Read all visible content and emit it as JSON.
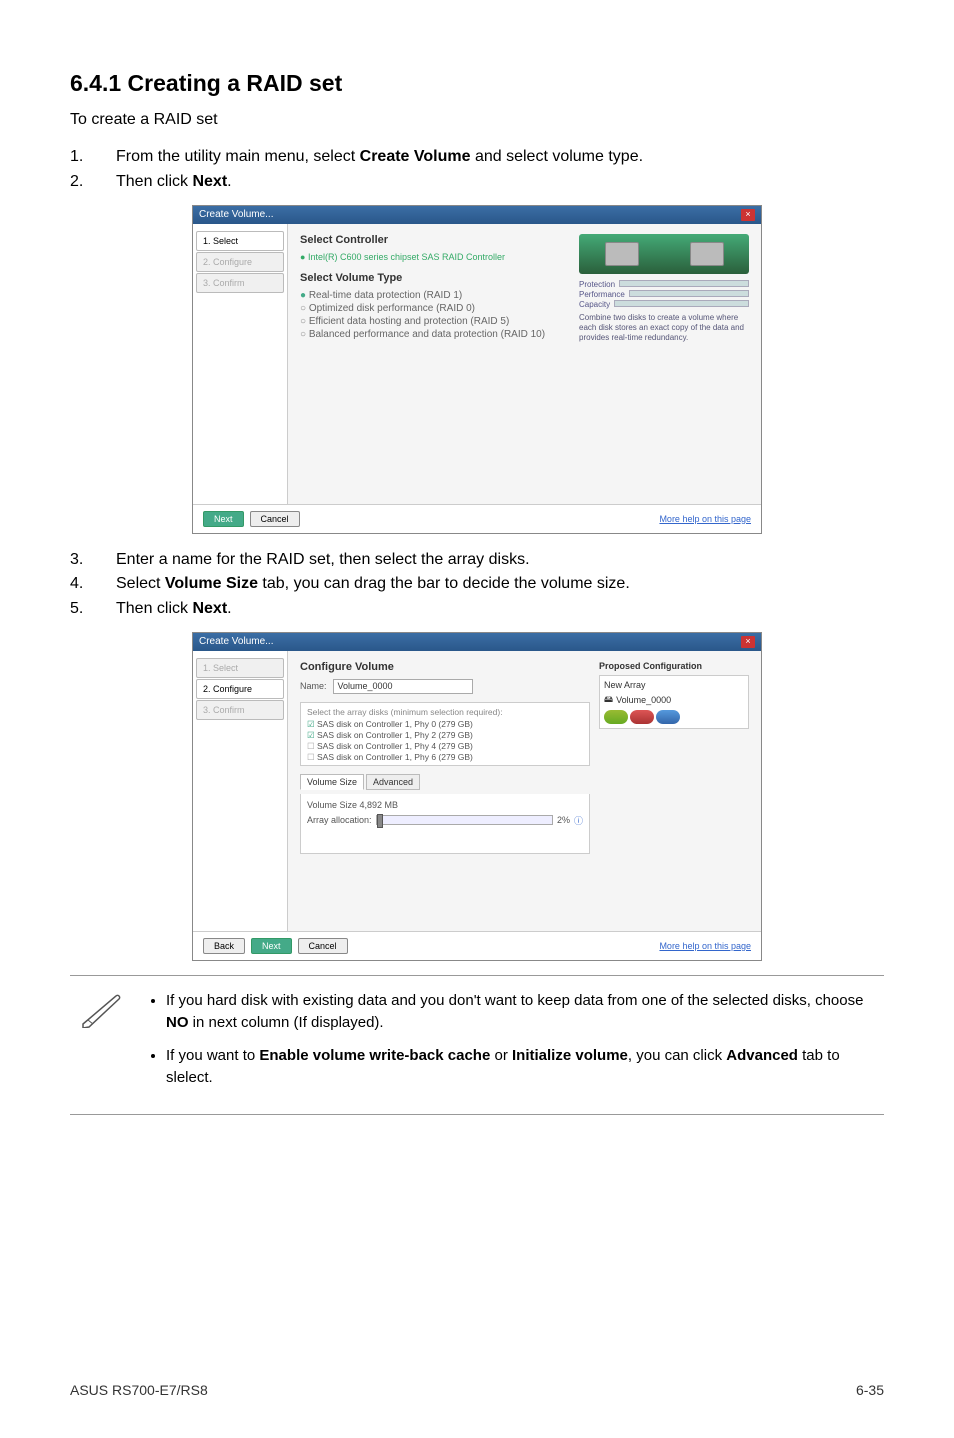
{
  "section": {
    "heading": "6.4.1    Creating a RAID set",
    "intro": "To create a RAID set"
  },
  "steps1": [
    {
      "num": "1.",
      "pre": "From the utility main menu, select ",
      "bold": "Create Volume",
      "post": " and select volume type."
    },
    {
      "num": "2.",
      "pre": "Then click ",
      "bold": "Next",
      "post": "."
    }
  ],
  "steps2": [
    {
      "num": "3.",
      "pre": "Enter a name for the RAID set, then select the array disks.",
      "bold": "",
      "post": ""
    },
    {
      "num": "4.",
      "pre": "Select ",
      "bold": "Volume Size",
      "post": " tab, you can drag the bar to decide the volume size."
    },
    {
      "num": "5.",
      "pre": "Then click ",
      "bold": "Next",
      "post": "."
    }
  ],
  "shot1": {
    "title": "Create Volume...",
    "left": [
      "1. Select",
      "2. Configure",
      "3. Confirm"
    ],
    "selectController": "Select Controller",
    "controller": "Intel(R) C600 series chipset SAS RAID Controller",
    "selectVolumeType": "Select Volume Type",
    "radios": [
      "Real-time data protection (RAID 1)",
      "Optimized disk performance (RAID 0)",
      "Efficient data hosting and protection (RAID 5)",
      "Balanced performance and data protection (RAID 10)"
    ],
    "metaLabels": {
      "prot": "Protection",
      "perf": "Performance",
      "cap": "Capacity"
    },
    "desc": "Combine two disks to create a volume where each disk stores an exact copy of the data and provides real-time redundancy.",
    "next": "Next",
    "cancel": "Cancel",
    "more": "More help on this page"
  },
  "shot2": {
    "title": "Create Volume...",
    "left": [
      "1. Select",
      "2. Configure",
      "3. Confirm"
    ],
    "hdr": "Configure Volume",
    "nameLabel": "Name:",
    "nameVal": "Volume_0000",
    "diskHint": "Select the array disks (minimum selection required):",
    "disks": [
      "SAS disk on Controller 1, Phy 0 (279 GB)",
      "SAS disk on Controller 1, Phy 2 (279 GB)",
      "SAS disk on Controller 1, Phy 4 (279 GB)",
      "SAS disk on Controller 1, Phy 6 (279 GB)"
    ],
    "tabs": {
      "vol": "Volume Size",
      "adv": "Advanced"
    },
    "volLine1": "Volume Size 4,892 MB",
    "volLine2": "Array allocation:",
    "volPct": "2% ",
    "proposed": "Proposed Configuration",
    "newArray": "New Array",
    "volName": "Volume_0000",
    "back": "Back",
    "next": "Next",
    "cancel": "Cancel",
    "more": "More help on this page"
  },
  "notes": {
    "n1a": "If you hard disk with existing data and you don't want to keep data from one of the selected disks, choose ",
    "n1b": "NO",
    "n1c": " in next column (If displayed).",
    "n2a": "If you want to ",
    "n2b": "Enable volume write-back cache",
    "n2c": " or ",
    "n2d": "Initialize volume",
    "n2e": ", you can click ",
    "n2f": "Advanced",
    "n2g": " tab to slelect."
  },
  "footer": {
    "left": "ASUS RS700-E7/RS8",
    "right": "6-35"
  }
}
